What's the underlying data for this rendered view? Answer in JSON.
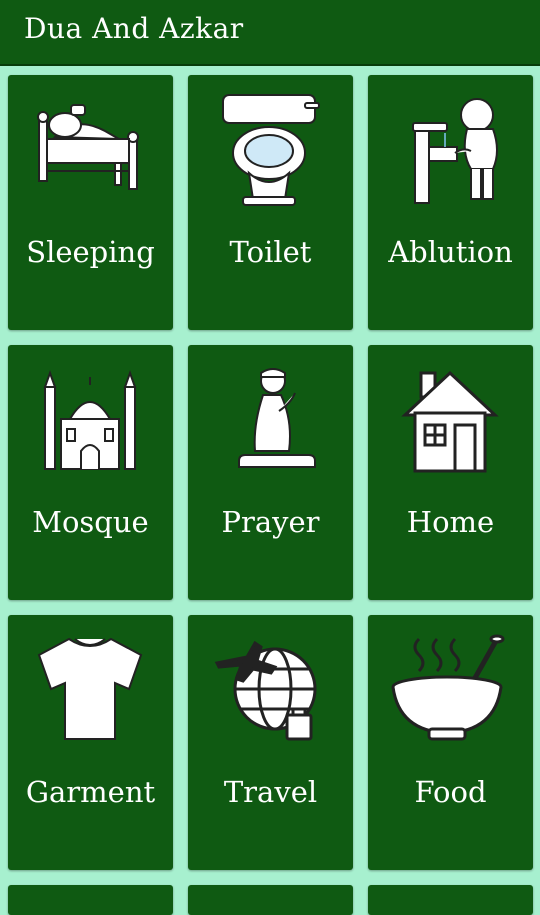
{
  "app_bar": {
    "title": "Dua And Azkar"
  },
  "categories": [
    {
      "label": "Sleeping",
      "icon": "bed-icon"
    },
    {
      "label": "Toilet",
      "icon": "toilet-icon"
    },
    {
      "label": "Ablution",
      "icon": "ablution-icon"
    },
    {
      "label": "Mosque",
      "icon": "mosque-icon"
    },
    {
      "label": "Prayer",
      "icon": "prayer-icon"
    },
    {
      "label": "Home",
      "icon": "house-icon"
    },
    {
      "label": "Garment",
      "icon": "tshirt-icon"
    },
    {
      "label": "Travel",
      "icon": "travel-icon"
    },
    {
      "label": "Food",
      "icon": "food-bowl-icon"
    }
  ],
  "colors": {
    "primary": "#0f5a12",
    "background": "#a7f0cf",
    "text": "#ffffff"
  }
}
